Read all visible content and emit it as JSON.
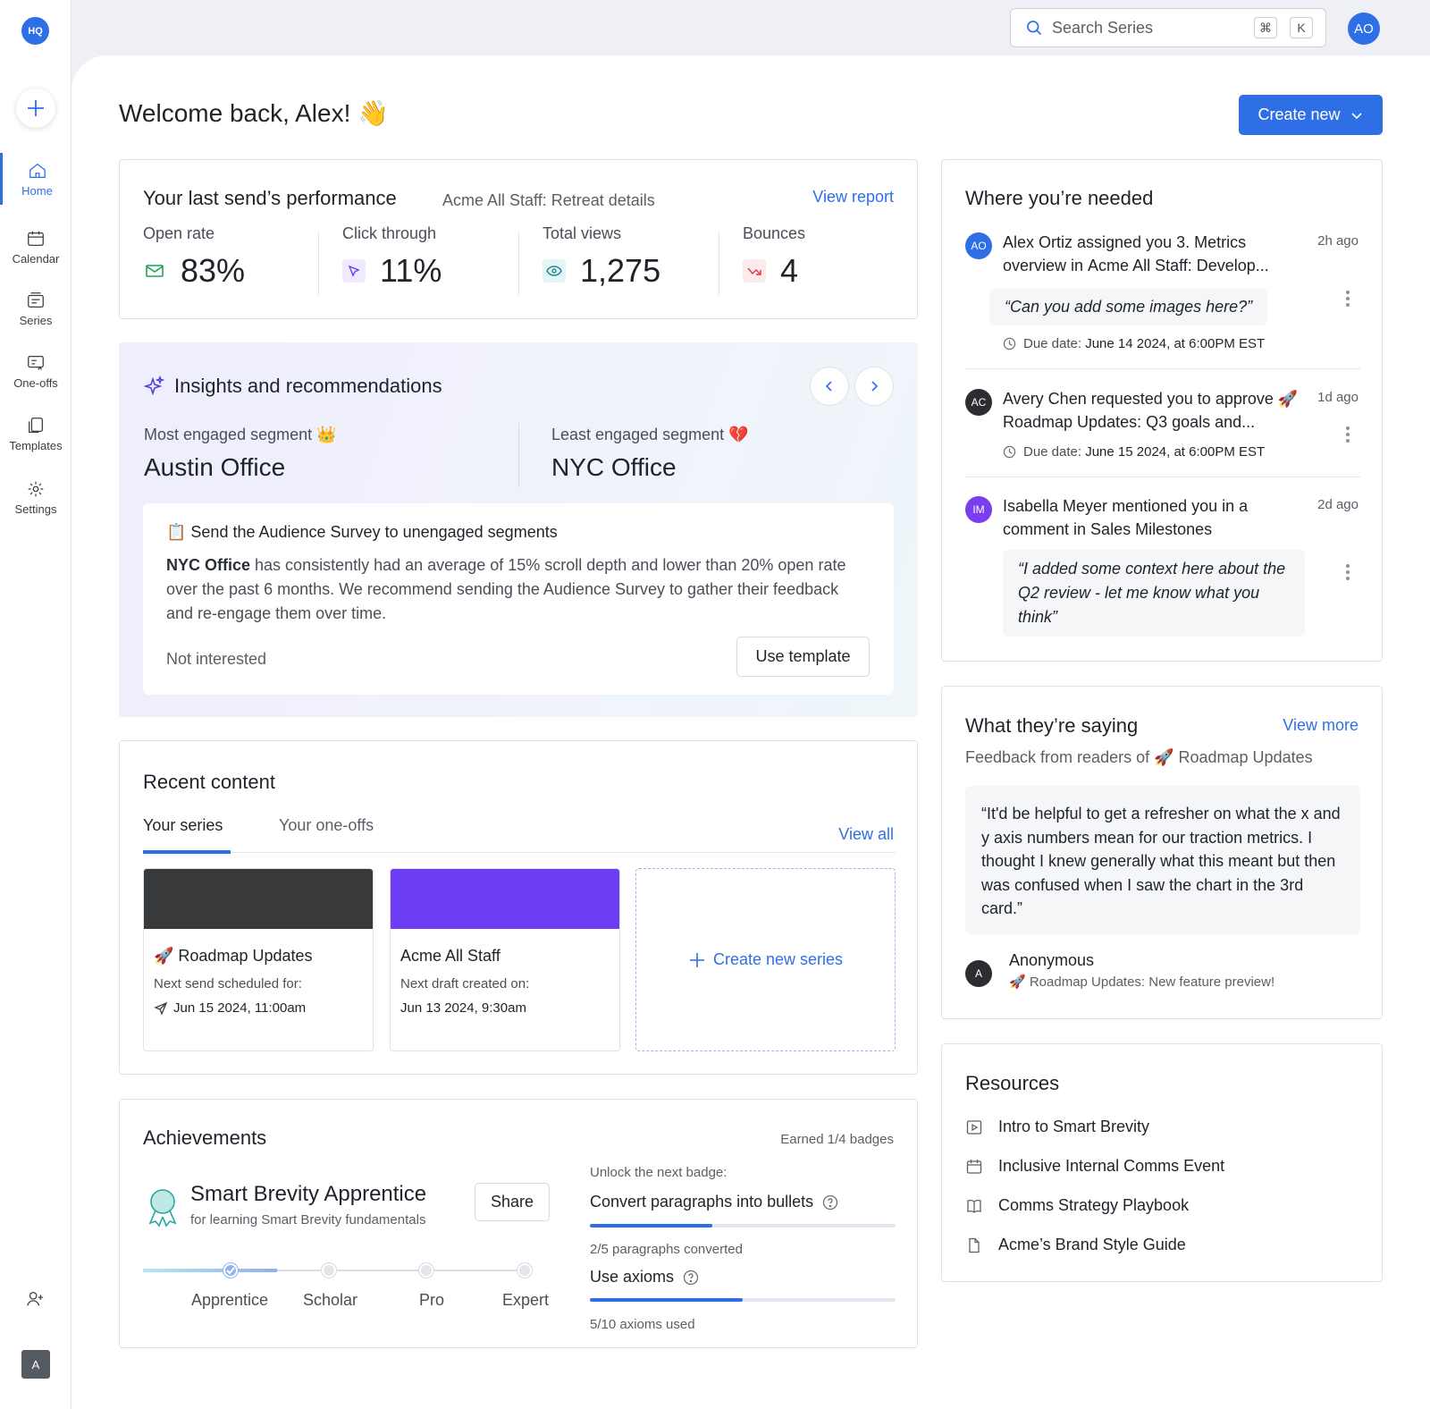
{
  "sidebar": {
    "logo": "HQ",
    "items": [
      {
        "label": "Home",
        "icon": "home-icon"
      },
      {
        "label": "Calendar",
        "icon": "calendar-icon"
      },
      {
        "label": "Series",
        "icon": "series-icon"
      },
      {
        "label": "One-offs",
        "icon": "one-offs-icon"
      },
      {
        "label": "Templates",
        "icon": "templates-icon"
      },
      {
        "label": "Settings",
        "icon": "gear-icon"
      }
    ],
    "user_initial": "A"
  },
  "topbar": {
    "search_placeholder": "Search Series",
    "shortcut_cmd": "⌘",
    "shortcut_key": "K",
    "user_initials": "AO"
  },
  "header": {
    "welcome": "Welcome back, Alex! 👋",
    "create_label": "Create new"
  },
  "performance": {
    "title": "Your last send’s performance",
    "subtitle": "Acme All Staff: Retreat details",
    "link": "View report",
    "metrics": [
      {
        "label": "Open rate",
        "value": "83%"
      },
      {
        "label": "Click through",
        "value": "11%"
      },
      {
        "label": "Total views",
        "value": "1,275"
      },
      {
        "label": "Bounces",
        "value": "4"
      }
    ]
  },
  "insights": {
    "title": "Insights and recommendations",
    "most_label": "Most engaged segment 👑",
    "most_value": "Austin Office",
    "least_label": "Least engaged segment 💔",
    "least_value": "NYC Office",
    "rec_title": "📋 Send the Audience Survey to unengaged segments",
    "rec_bold": "NYC Office",
    "rec_body": " has consistently had an average of 15% scroll depth and lower than 20% open rate over the past 6 months. We recommend sending the Audience Survey to gather their feedback and re-engage them over time.",
    "dismiss": "Not interested",
    "cta": "Use template"
  },
  "recent": {
    "title": "Recent content",
    "tabs": [
      "Your series",
      "Your one-offs"
    ],
    "view_all": "View all",
    "tiles": [
      {
        "title": "🚀 Roadmap Updates",
        "line": "Next send scheduled for:",
        "date": "Jun 15 2024, 11:00am",
        "color": "#38393b"
      },
      {
        "title": "Acme All Staff",
        "line": "Next draft created on:",
        "date": "Jun 13 2024, 9:30am",
        "color": "#6c3df5"
      }
    ],
    "new_series": "Create new series"
  },
  "achievements": {
    "title": "Achievements",
    "earned": "Earned 1/4 badges",
    "badge_name": "Smart Brevity Apprentice",
    "badge_desc": "for learning Smart Brevity fundamentals",
    "share": "Share",
    "levels": [
      "Apprentice",
      "Scholar",
      "Pro",
      "Expert"
    ],
    "current_level_index": 0,
    "unlock_label": "Unlock the next badge:",
    "goals": [
      {
        "label": "Convert paragraphs into bullets",
        "progress": 0.4,
        "status": "2/5 paragraphs converted"
      },
      {
        "label": "Use axioms",
        "progress": 0.5,
        "status": "5/10 axioms used"
      }
    ]
  },
  "needed": {
    "title": "Where you’re needed",
    "items": [
      {
        "initials": "AO",
        "avatar_color": "#2f6fe6",
        "name": "Alex Ortiz",
        "action": " assigned you ",
        "target": "3. Metrics overview",
        "mid": " in ",
        "place": "Acme All Staff: Develop...",
        "time": "2h ago",
        "quote": "“Can you add some images here?”",
        "due_label": "Due date: ",
        "due": "June 14 2024, at 6:00PM EST"
      },
      {
        "initials": "AC",
        "avatar_color": "#2b2d31",
        "name": "Avery Chen",
        "action": " requested you to approve ",
        "target": "🚀 Roadmap Updates: Q3 goals and...",
        "time": "1d ago",
        "due_label": "Due date: ",
        "due": "June 15 2024, at 6:00PM EST"
      },
      {
        "initials": "IM",
        "avatar_color": "#7a3df0",
        "name": "Isabella Meyer",
        "action": " mentioned you in a comment in ",
        "target": "Sales Milestones",
        "time": "2d ago",
        "quote": "“I added some context here about the Q2 review - let me know what you think”"
      }
    ]
  },
  "saying": {
    "title": "What they’re saying",
    "link": "View more",
    "subtitle": "Feedback from readers of 🚀 Roadmap Updates",
    "quote": "“It'd be helpful to get a refresher on what the x and y axis numbers mean for our traction metrics. I thought I knew generally what this meant but then was confused when I saw the chart in the 3rd card.”",
    "author_initial": "A",
    "author": "Anonymous",
    "source": "🚀 Roadmap Updates: New feature preview!"
  },
  "resources": {
    "title": "Resources",
    "items": [
      {
        "label": "Intro to Smart Brevity",
        "icon": "play-icon"
      },
      {
        "label": "Inclusive Internal Comms Event",
        "icon": "calendar-icon"
      },
      {
        "label": "Comms Strategy Playbook",
        "icon": "book-icon"
      },
      {
        "label": "Acme’s Brand Style Guide",
        "icon": "file-icon"
      }
    ]
  }
}
